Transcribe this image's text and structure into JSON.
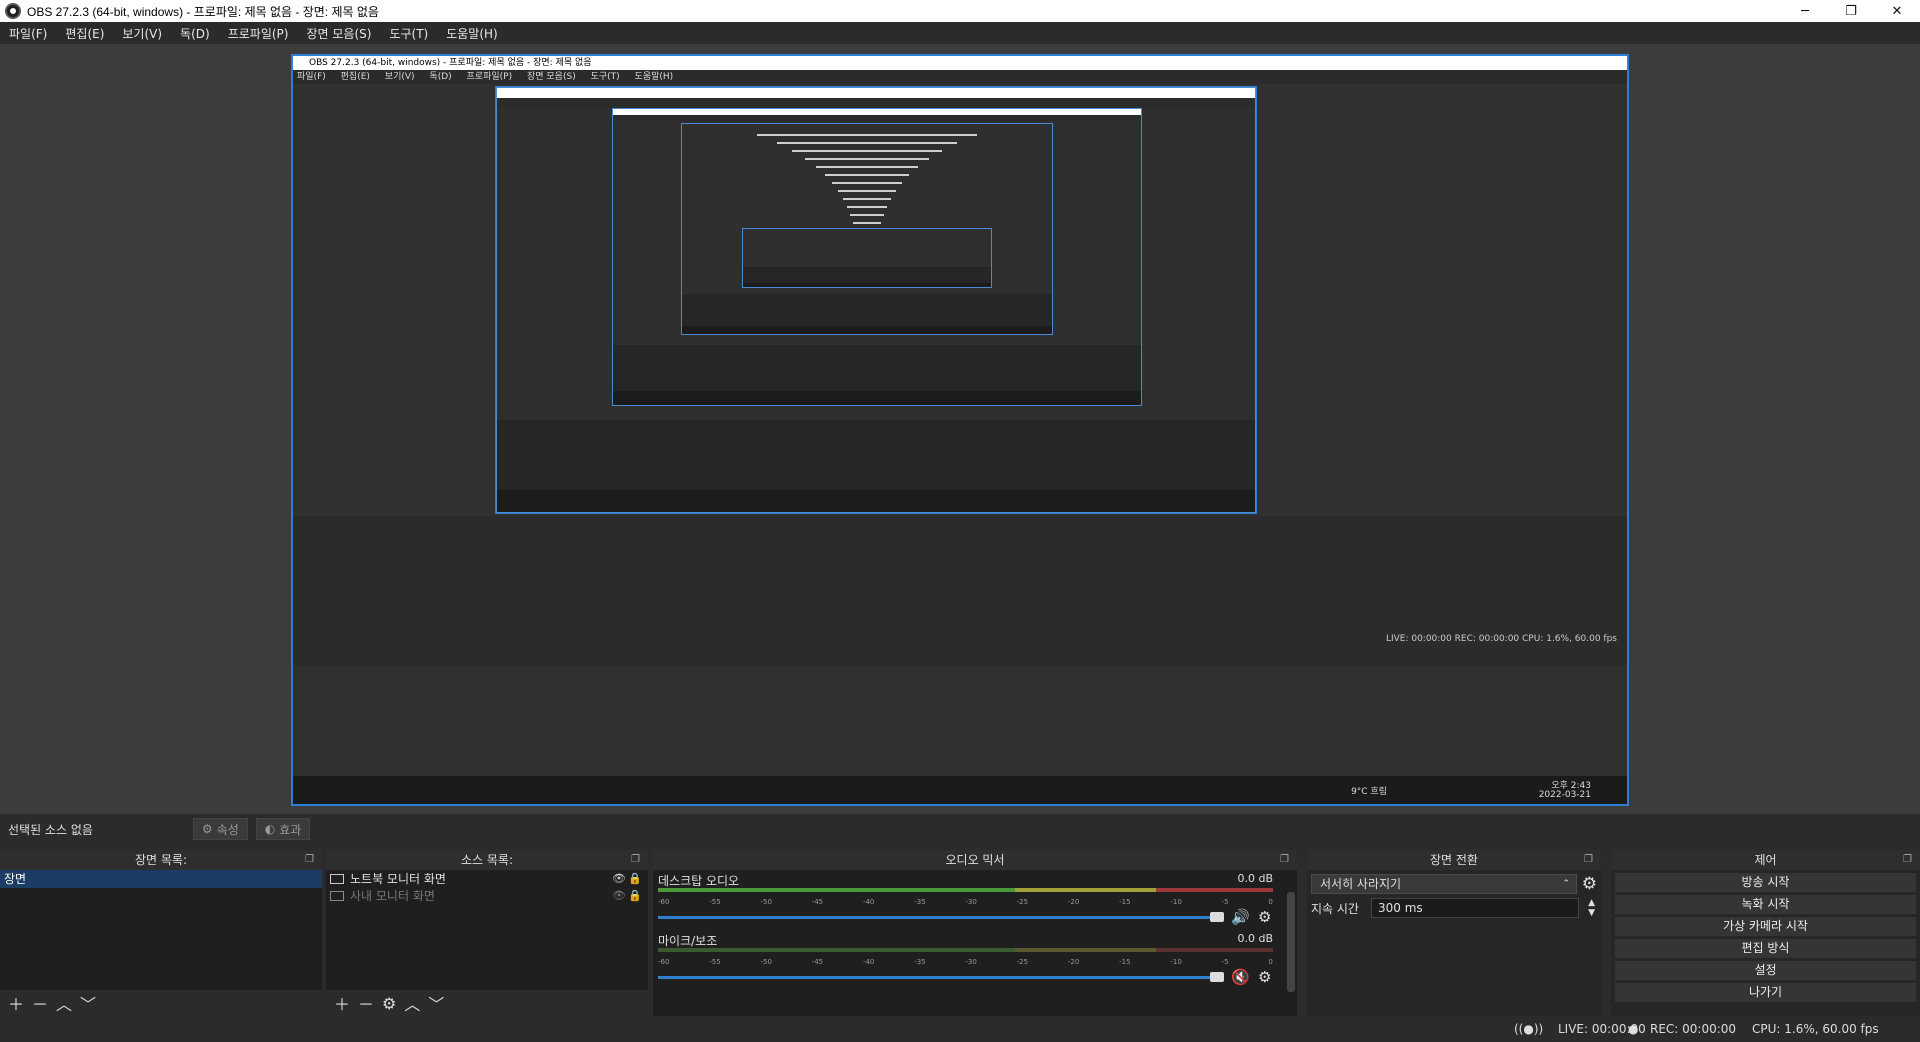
{
  "window": {
    "title": "OBS 27.2.3 (64-bit, windows) - 프로파일: 제목 없음 - 장면: 제목 없음",
    "controls": [
      "─",
      "❐",
      "✕"
    ]
  },
  "menu": [
    "파일(F)",
    "편집(E)",
    "보기(V)",
    "독(D)",
    "프로파일(P)",
    "장면 모음(S)",
    "도구(T)",
    "도움말(H)"
  ],
  "preview": {
    "inner_title": "OBS 27.2.3 (64-bit, windows) - 프로파일: 제목 없음 - 장면: 제목 없음",
    "inner_menu": [
      "파일(F)",
      "편집(E)",
      "보기(V)",
      "독(D)",
      "프로파일(P)",
      "장면 모음(S)",
      "도구(T)",
      "도움말(H)"
    ],
    "inner_status": "LIVE: 00:00:00   REC: 00:00:00   CPU: 1.6%, 60.00 fps",
    "inner_clock": "오후 2:43",
    "inner_date": "2022-03-21",
    "inner_weather": "9°C 흐림"
  },
  "source_toolbar": {
    "no_source": "선택된 소스 없음",
    "properties": "속성",
    "filters": "효과"
  },
  "scenes": {
    "title": "장면 목록:",
    "items": [
      "장면"
    ]
  },
  "sources": {
    "title": "소스 목록:",
    "items": [
      "노트북 모니터 화면",
      "사내 모니터 화면"
    ]
  },
  "mixer": {
    "title": "오디오 믹서",
    "channels": [
      {
        "name": "데스크탑 오디오",
        "db": "0.0 dB",
        "muted": false
      },
      {
        "name": "마이크/보조",
        "db": "0.0 dB",
        "muted": true
      }
    ],
    "ticks": [
      "-60",
      "-55",
      "-50",
      "-45",
      "-40",
      "-35",
      "-30",
      "-25",
      "-20",
      "-15",
      "-10",
      "-5",
      "0"
    ]
  },
  "transitions": {
    "title": "장면 전환",
    "selected": "서서히 사라지기",
    "duration_label": "지속 시간",
    "duration_value": "300 ms"
  },
  "controls": {
    "title": "제어",
    "buttons": [
      "방송 시작",
      "녹화 시작",
      "가상 카메라 시작",
      "편집 방식",
      "설정",
      "나가기"
    ]
  },
  "status": {
    "live": "LIVE: 00:00:00",
    "rec": "REC: 00:00:00",
    "cpu": "CPU: 1.6%, 60.00 fps"
  }
}
